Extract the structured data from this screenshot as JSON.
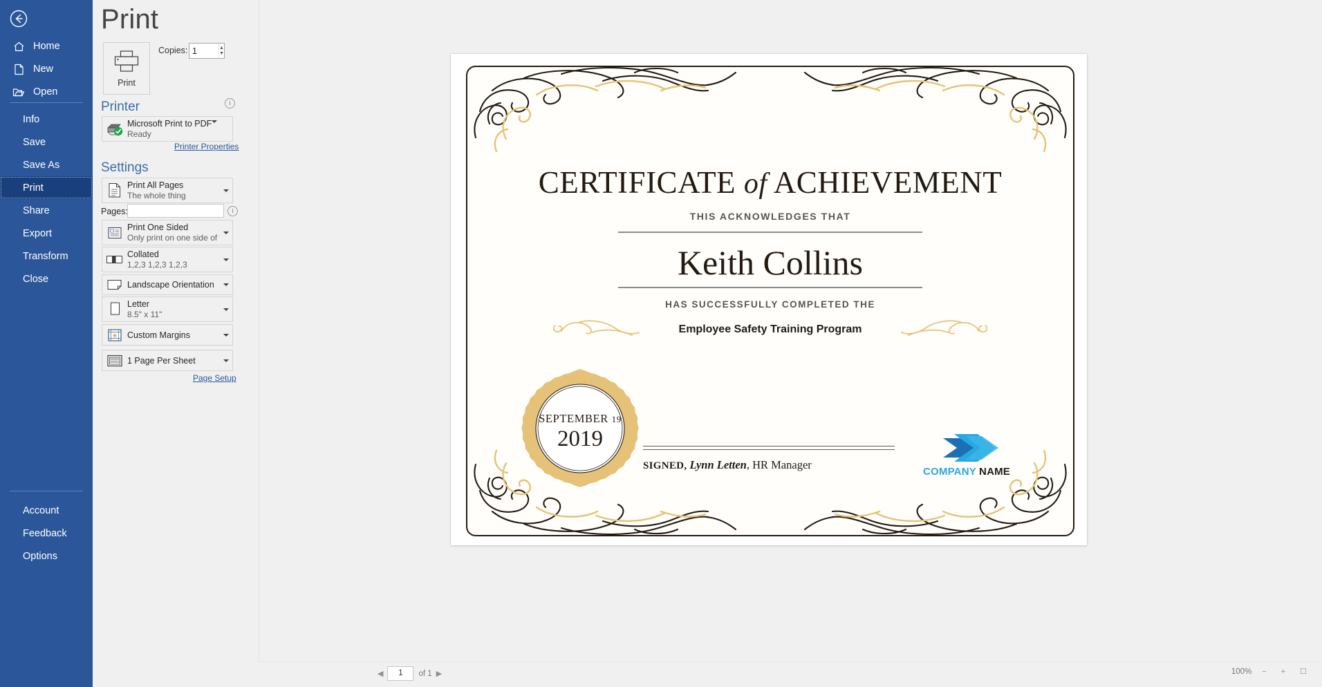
{
  "nav": {
    "back_icon": "back-arrow-icon",
    "top_items": [
      {
        "label": "Home",
        "icon": "home-icon"
      },
      {
        "label": "New",
        "icon": "new-document-icon"
      },
      {
        "label": "Open",
        "icon": "open-folder-icon"
      }
    ],
    "items": [
      {
        "label": "Info",
        "selected": false
      },
      {
        "label": "Save",
        "selected": false
      },
      {
        "label": "Save As",
        "selected": false
      },
      {
        "label": "Print",
        "selected": true
      },
      {
        "label": "Share",
        "selected": false
      },
      {
        "label": "Export",
        "selected": false
      },
      {
        "label": "Transform",
        "selected": false
      },
      {
        "label": "Close",
        "selected": false
      }
    ],
    "bottom_items": [
      {
        "label": "Account"
      },
      {
        "label": "Feedback"
      },
      {
        "label": "Options"
      }
    ]
  },
  "page": {
    "title": "Print"
  },
  "print_button": {
    "label": "Print",
    "icon": "printer-icon"
  },
  "copies": {
    "label": "Copies:",
    "value": "1"
  },
  "printer": {
    "heading": "Printer",
    "info_icon": "info-icon",
    "name": "Microsoft Print to PDF",
    "status": "Ready",
    "properties_link": "Printer Properties",
    "icon": "printer-ready-icon"
  },
  "settings": {
    "heading": "Settings",
    "pages_label": "Pages:",
    "pages_value": "",
    "pages_info_icon": "info-icon",
    "page_setup_link": "Page Setup",
    "rows": [
      {
        "title": "Print All Pages",
        "sub": "The whole thing",
        "icon": "all-pages-icon"
      },
      {
        "title": "Print One Sided",
        "sub": "Only print on one side of th...",
        "icon": "one-sided-icon"
      },
      {
        "title": "Collated",
        "sub": "1,2,3   1,2,3   1,2,3",
        "icon": "collated-icon"
      },
      {
        "title": "Landscape Orientation",
        "sub": "",
        "icon": "landscape-icon"
      },
      {
        "title": "Letter",
        "sub": "8.5\" x 11\"",
        "icon": "paper-size-icon"
      },
      {
        "title": "Custom Margins",
        "sub": "",
        "icon": "margins-icon"
      },
      {
        "title": "1 Page Per Sheet",
        "sub": "",
        "icon": "pages-per-sheet-icon"
      }
    ]
  },
  "certificate": {
    "title_part1": "CERTIFICATE",
    "title_of": "of",
    "title_part2": "ACHIEVEMENT",
    "acknowledges": "THIS ACKNOWLEDGES THAT",
    "recipient": "Keith Collins",
    "completed": "HAS SUCCESSFULLY COMPLETED THE",
    "program": "Employee Safety Training Program",
    "seal_month_day": "SEPTEMBER",
    "seal_day": "19",
    "seal_year": "2019",
    "signed_word": "SIGNED,",
    "signer_name": "Lynn Letten",
    "signer_title": ", HR Manager",
    "logo_text_part1": "COMPANY",
    "logo_text_part2": "NAME",
    "logo_icon": "chevron-logo-icon",
    "colors": {
      "ink": "#241a12",
      "gold": "#e6c278",
      "rule": "#8c8c8c",
      "logo_light": "#29a8e0",
      "logo_dark": "#1b6fb5"
    }
  },
  "status_bar": {
    "page_number": "1",
    "page_count": "of 1",
    "prev_icon": "prev-page-icon",
    "next_icon": "next-page-icon",
    "zoom_percent": "100%",
    "zoom_out_icon": "zoom-out-icon",
    "zoom_in_icon": "zoom-in-icon",
    "fit_page_icon": "fit-to-page-icon"
  }
}
